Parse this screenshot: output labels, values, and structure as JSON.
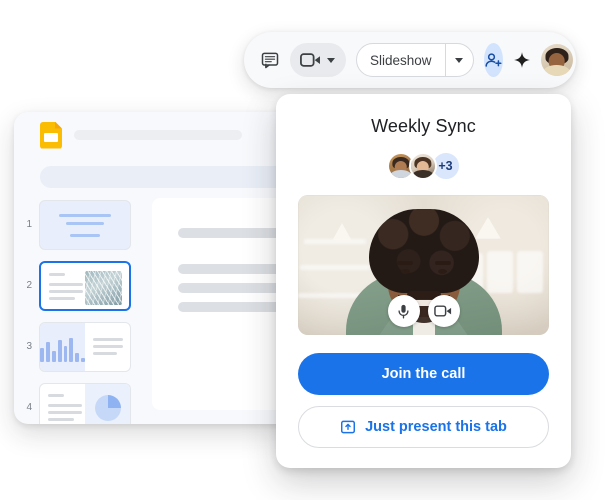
{
  "meta": {
    "accent_blue": "#1a73e8",
    "badge_blue": "#d2e3fd",
    "slides_yellow": "#fbbc04"
  },
  "meet_toolbar": {
    "chat_icon": "chat-bubble-icon",
    "camera_label": "camera-icon",
    "camera_caret": "chevron-down-icon",
    "slideshow_label": "Slideshow",
    "slideshow_caret": "chevron-down-icon",
    "add_people_icon": "add-person-icon",
    "sparkle_icon": "sparkle-icon",
    "avatar": "user-avatar"
  },
  "join_card": {
    "title": "Weekly Sync",
    "participants": [
      {
        "name": "participant-1-avatar"
      },
      {
        "name": "participant-2-avatar"
      }
    ],
    "overflow_badge": "+3",
    "video": {
      "mic_icon": "microphone-icon",
      "camera_icon": "camera-icon",
      "self_preview": "self-video-preview"
    },
    "join_button": "Join the call",
    "present_button": "Just present this tab",
    "present_icon": "present-to-tab-icon"
  },
  "slides_window": {
    "app_icon": "google-slides-icon",
    "title_placeholder": "",
    "filmstrip": [
      {
        "number": "1",
        "kind": "title-slide"
      },
      {
        "number": "2",
        "kind": "image-slide",
        "selected": true
      },
      {
        "number": "3",
        "kind": "bar-chart-slide"
      },
      {
        "number": "4",
        "kind": "pie-chart-slide"
      }
    ],
    "bar_values": [
      14,
      20,
      11,
      22,
      16,
      24,
      9,
      4
    ],
    "main_slide": {
      "kind": "text-slide",
      "lines": 4
    }
  }
}
